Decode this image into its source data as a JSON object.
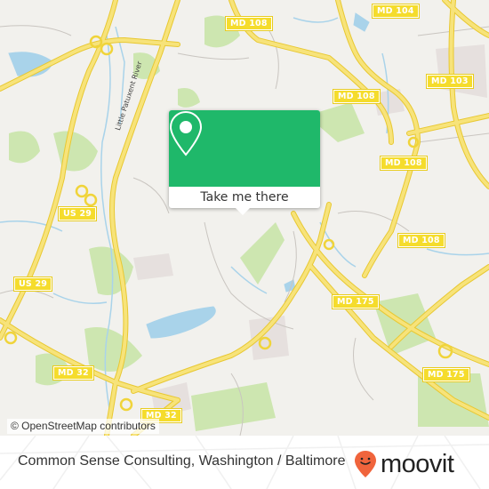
{
  "map": {
    "road_labels": [
      {
        "id": "md108-top",
        "text": "MD 108"
      },
      {
        "id": "md104",
        "text": "MD 104"
      },
      {
        "id": "md108-mid",
        "text": "MD 108"
      },
      {
        "id": "md103",
        "text": "MD 103"
      },
      {
        "id": "md108-right",
        "text": "MD 108"
      },
      {
        "id": "md108-lower",
        "text": "MD 108"
      },
      {
        "id": "us29-upper",
        "text": "US 29"
      },
      {
        "id": "us29-lower",
        "text": "US 29"
      },
      {
        "id": "md175-mid",
        "text": "MD 175"
      },
      {
        "id": "md175-right",
        "text": "MD 175"
      },
      {
        "id": "md32-left",
        "text": "MD 32"
      },
      {
        "id": "md32-bottom",
        "text": "MD 32"
      }
    ],
    "river_label": "Little Patuxent River",
    "attribution": "© OpenStreetMap contributors",
    "colors": {
      "land": "#f2f1ed",
      "park": "#cde6b0",
      "water": "#a9d3ea",
      "road": "#f5dc4a",
      "road_label_bg": "#f5dc2c"
    }
  },
  "popup": {
    "icon": "map-pin-icon",
    "action_label": "Take me there",
    "accent_color": "#1fb86a"
  },
  "footer": {
    "place_title": "Common Sense Consulting, Washington / Baltimore",
    "brand": "moovit",
    "brand_color": "#f0643c"
  }
}
